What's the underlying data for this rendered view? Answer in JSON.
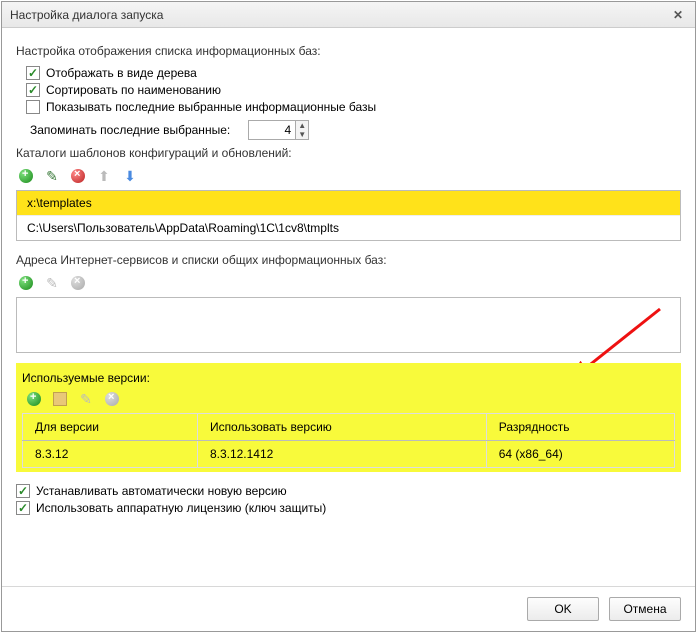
{
  "titlebar": {
    "title": "Настройка диалога запуска"
  },
  "section1": {
    "title": "Настройка отображения списка информационных баз:",
    "cb_tree": "Отображать в виде дерева",
    "cb_sort": "Сортировать по наименованию",
    "cb_recent": "Показывать последние выбранные информационные базы",
    "remember_label": "Запоминать последние выбранные:",
    "remember_value": "4"
  },
  "section2": {
    "title": "Каталоги шаблонов конфигураций и обновлений:",
    "items": [
      "x:\\templates",
      "C:\\Users\\Пользователь\\AppData\\Roaming\\1C\\1cv8\\tmplts"
    ]
  },
  "section3": {
    "title": "Адреса Интернет-сервисов и списки общих информационных баз:"
  },
  "versions": {
    "title": "Используемые версии:",
    "headers": {
      "for": "Для версии",
      "use": "Использовать версию",
      "arch": "Разрядность"
    },
    "rows": [
      {
        "for": "8.3.12",
        "use": "8.3.12.1412",
        "arch": "64 (x86_64)"
      }
    ]
  },
  "bottom": {
    "auto_update": "Устанавливать автоматически новую версию",
    "hw_license": "Использовать аппаратную лицензию (ключ защиты)"
  },
  "buttons": {
    "ok": "OK",
    "cancel": "Отмена"
  }
}
